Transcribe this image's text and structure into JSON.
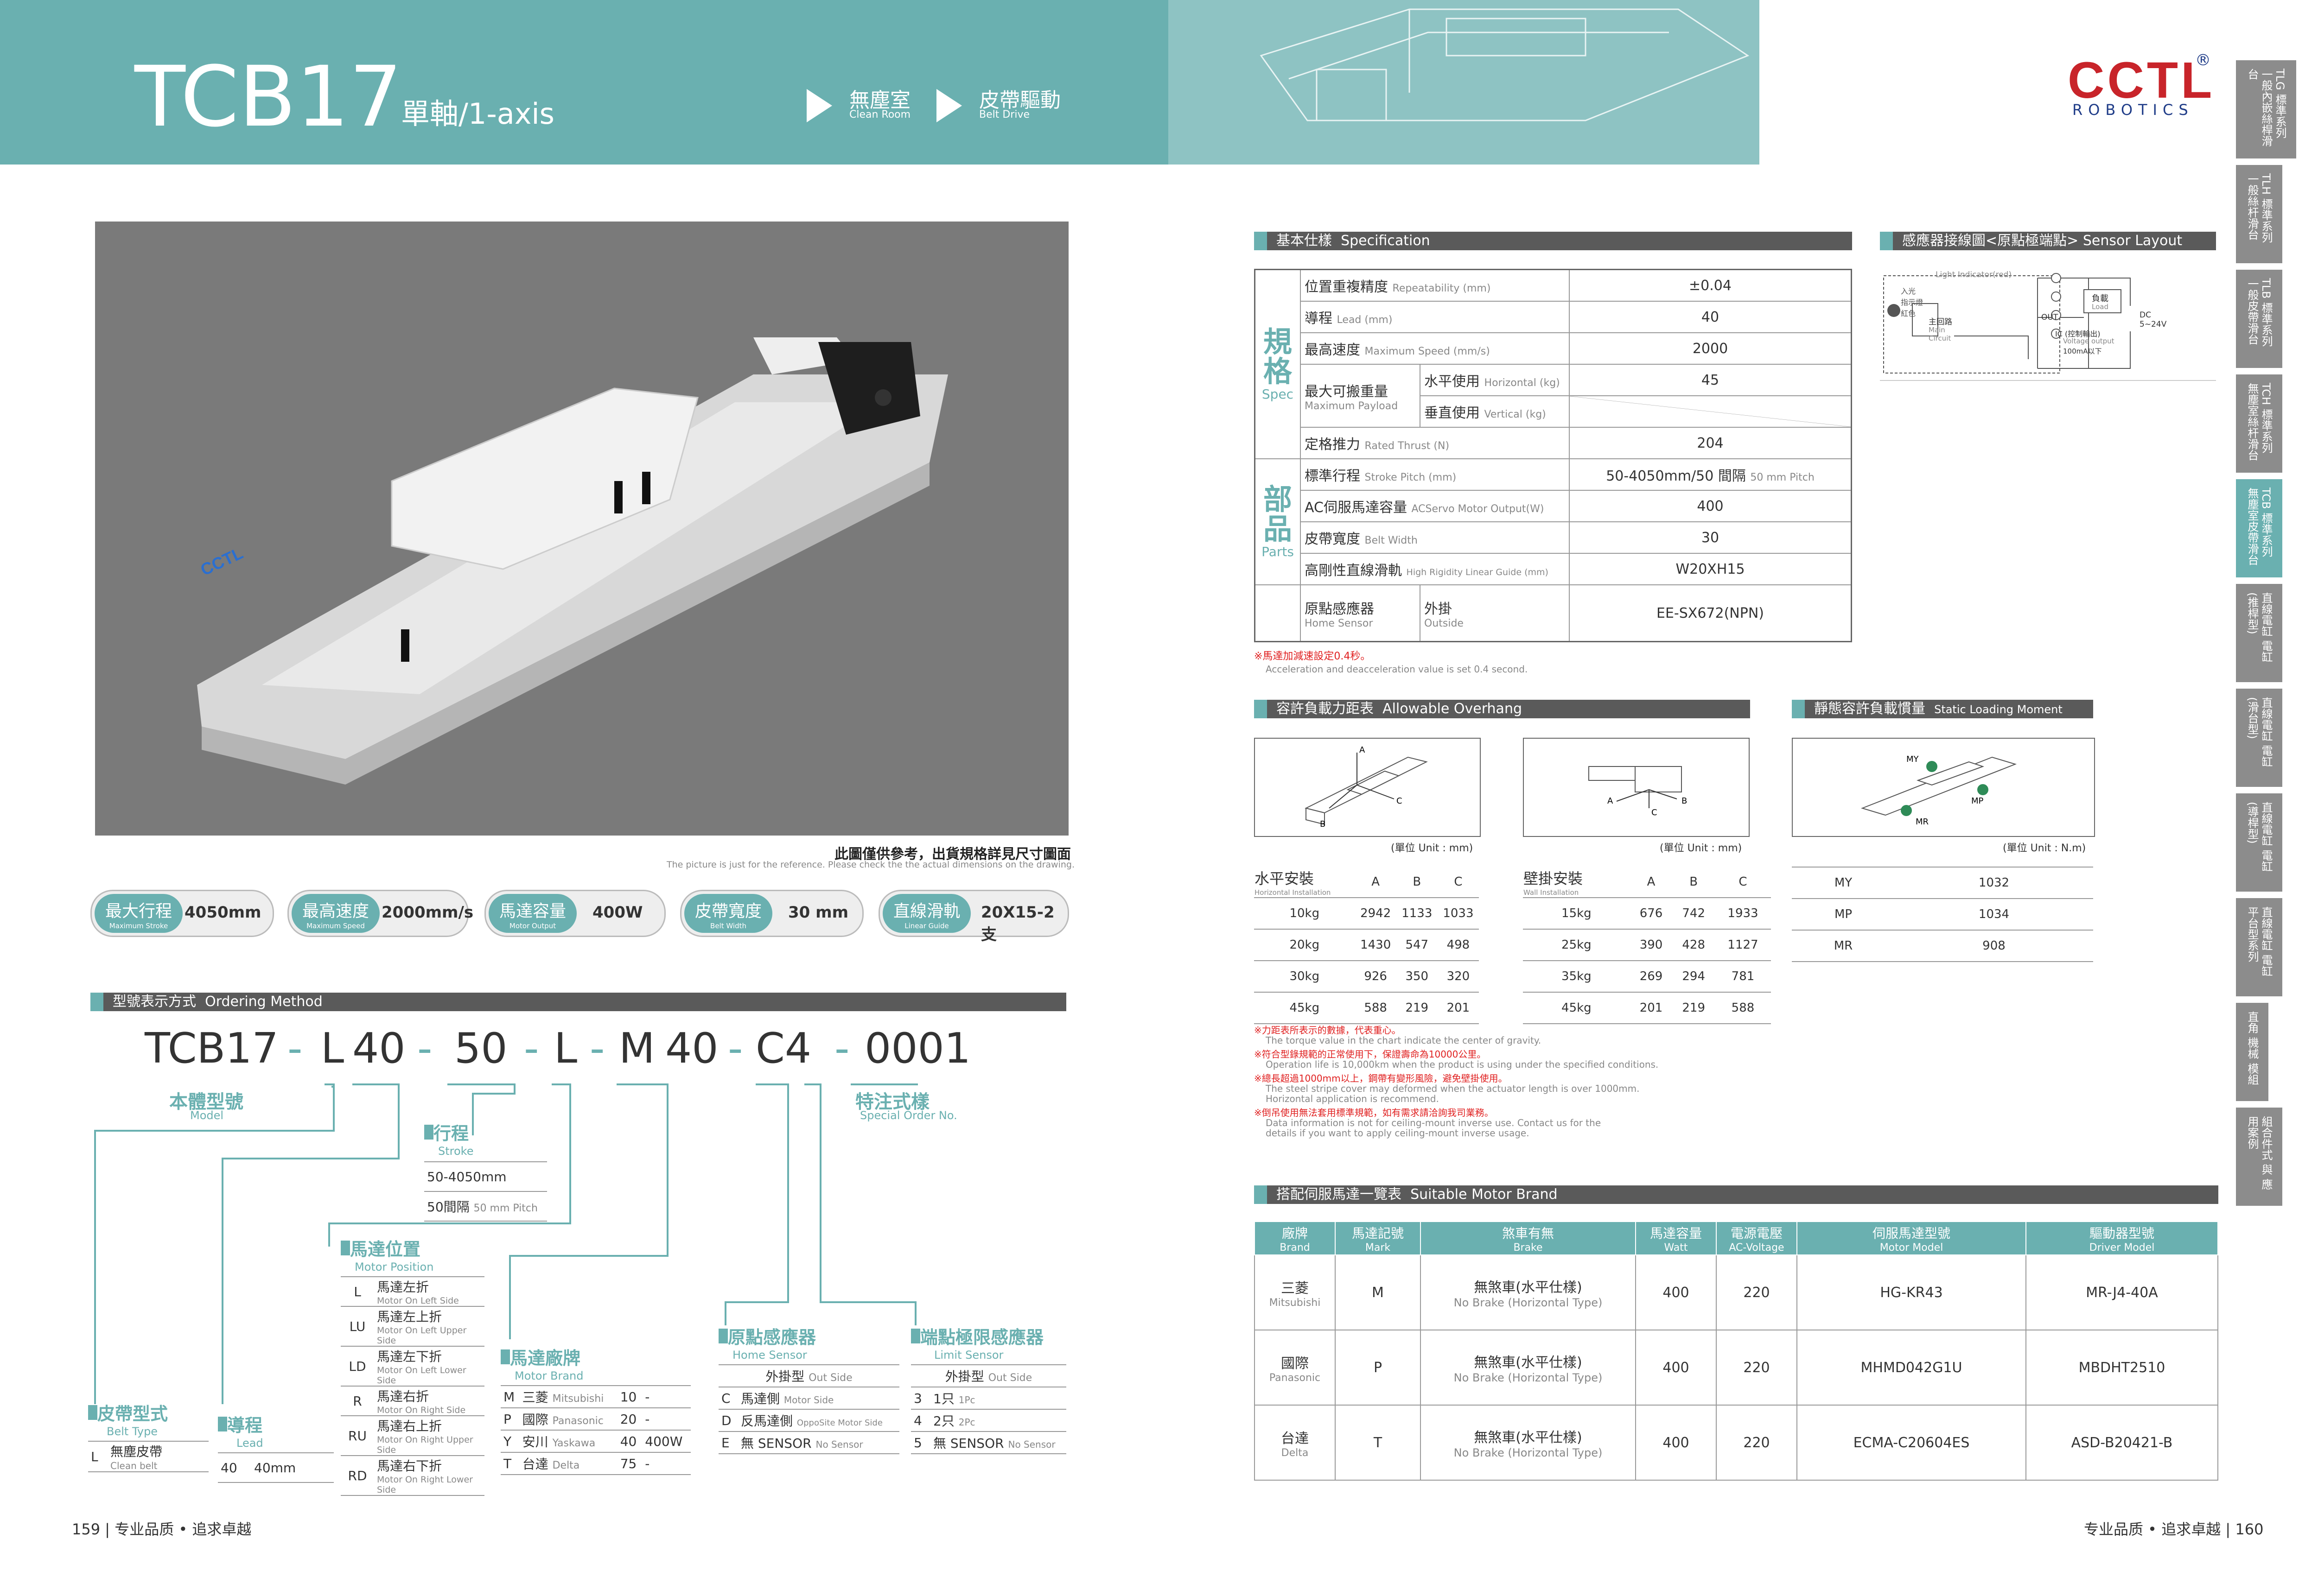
{
  "header": {
    "model": "TCB17",
    "axis": "單軸/1-axis",
    "tags": [
      {
        "zh": "無塵室",
        "en": "Clean Room"
      },
      {
        "zh": "皮帶驅動",
        "en": "Belt Drive"
      }
    ],
    "logo": {
      "brand": "CCTL",
      "reg": "®",
      "sub": "ROBOTICS"
    }
  },
  "side_tabs": [
    {
      "label": "TLG\n標準系列\n一般內嵌絲桿滑台"
    },
    {
      "label": "TLH\n標準系列\n一般絲杆滑台"
    },
    {
      "label": "TLB\n標準系列\n一般皮帶滑台"
    },
    {
      "label": "TCH\n標準系列\n無塵室絲杆滑台"
    },
    {
      "label": "TCB\n標準系列\n無塵室皮帶滑台"
    },
    {
      "label": "直線電缸\n電缸\n(推桿型)"
    },
    {
      "label": "直線電缸\n電缸\n(滑台型)"
    },
    {
      "label": "直線電缸\n電缸\n(導桿型)"
    },
    {
      "label": "直線電缸\n電缸\n平台型系列"
    },
    {
      "label": "直角\n機械\n模組"
    },
    {
      "label": "組合件式\n與\n應用案例"
    }
  ],
  "photo_note": {
    "zh": "此圖僅供參考，出貨規格詳見尺寸圖面",
    "en": "The picture is just for the reference. Please check the the actual dimensions on the drawing."
  },
  "pills": [
    {
      "zh": "最大行程",
      "en": "Maximum Stroke",
      "val": "4050mm"
    },
    {
      "zh": "最高速度",
      "en": "Maximum Speed",
      "val": "2000mm/s"
    },
    {
      "zh": "馬達容量",
      "en": "Motor Output",
      "val": "400W"
    },
    {
      "zh": "皮帶寬度",
      "en": "Belt Width",
      "val": "30 mm"
    },
    {
      "zh": "直線滑軌",
      "en": "Linear Guide",
      "val": "20X15-2支"
    }
  ],
  "ordering": {
    "title": "型號表示方式",
    "title_en": "Ordering Method",
    "code": [
      "TCB17",
      "-",
      "L",
      "40",
      "-",
      "50",
      "-",
      "L",
      "-",
      "M",
      "40",
      "-",
      "C4",
      "-",
      "0001"
    ],
    "model": {
      "zh": "本體型號",
      "en": "Model"
    },
    "special": {
      "zh": "特注式樣",
      "en": "Special Order No."
    },
    "stroke": {
      "zh": "行程",
      "en": "Stroke",
      "rows": [
        {
          "a": "50-4050mm",
          "b": ""
        },
        {
          "a": "50間隔",
          "b": "50 mm Pitch"
        }
      ]
    },
    "position": {
      "zh": "馬達位置",
      "en": "Motor Position",
      "rows": [
        {
          "k": "L",
          "zh": "馬達左折",
          "en": "Motor On Left Side"
        },
        {
          "k": "LU",
          "zh": "馬達左上折",
          "en": "Motor On Left Upper Side"
        },
        {
          "k": "LD",
          "zh": "馬達左下折",
          "en": "Motor On Left Lower Side"
        },
        {
          "k": "R",
          "zh": "馬達右折",
          "en": "Motor On Right Side"
        },
        {
          "k": "RU",
          "zh": "馬達右上折",
          "en": "Motor On Right Upper Side"
        },
        {
          "k": "RD",
          "zh": "馬達右下折",
          "en": "Motor On Right Lower Side"
        }
      ]
    },
    "brand": {
      "zh": "馬達廠牌",
      "en": "Motor Brand",
      "rows": [
        {
          "k": "M",
          "zh": "三菱",
          "en": "Mitsubishi",
          "n": "10",
          "w": "-"
        },
        {
          "k": "P",
          "zh": "國際",
          "en": "Panasonic",
          "n": "20",
          "w": "-"
        },
        {
          "k": "Y",
          "zh": "安川",
          "en": "Yaskawa",
          "n": "40",
          "w": "400W"
        },
        {
          "k": "T",
          "zh": "台達",
          "en": "Delta",
          "n": "75",
          "w": "-"
        }
      ]
    },
    "home": {
      "zh": "原點感應器",
      "en": "Home Sensor",
      "head_zh": "外掛型",
      "head_en": "Out Side",
      "rows": [
        {
          "k": "C",
          "zh": "馬達側",
          "en": "Motor Side"
        },
        {
          "k": "D",
          "zh": "反馬達側",
          "en": "OppoSite Motor Side"
        },
        {
          "k": "E",
          "zh": "無 SENSOR",
          "en": "No Sensor"
        }
      ]
    },
    "limit": {
      "zh": "端點極限感應器",
      "en": "Limit Sensor",
      "head_zh": "外掛型",
      "head_en": "Out Side",
      "rows": [
        {
          "k": "3",
          "zh": "1只",
          "en": "1Pc"
        },
        {
          "k": "4",
          "zh": "2只",
          "en": "2Pc"
        },
        {
          "k": "5",
          "zh": "無 SENSOR",
          "en": "No Sensor"
        }
      ]
    },
    "belt": {
      "zh": "皮帶型式",
      "en": "Belt Type",
      "k": "L",
      "v_zh": "無塵皮帶",
      "v_en": "Clean belt"
    },
    "lead": {
      "zh": "導程",
      "en": "Lead",
      "k": "40",
      "v": "40mm"
    }
  },
  "spec": {
    "title": "基本仕樣",
    "title_en": "Specification",
    "group1": {
      "zh": "規格",
      "en": "Spec"
    },
    "group2": {
      "zh": "部品",
      "en": "Parts"
    },
    "rows": [
      {
        "zh": "位置重複精度",
        "en": "Repeatability (mm)",
        "v": "±0.04"
      },
      {
        "zh": "導程",
        "en": "Lead (mm)",
        "v": "40"
      },
      {
        "zh": "最高速度",
        "en": "Maximum Speed (mm/s)",
        "v": "2000"
      },
      {
        "zh": "最大可搬重量",
        "en": "Maximum Payload",
        "h_zh": "水平使用",
        "h_en": "Horizontal (kg)",
        "h_v": "45",
        "v_zh": "垂直使用",
        "v_en": "Vertical (kg)"
      },
      {
        "zh": "定格推力",
        "en": "Rated Thrust (N)",
        "v": "204"
      },
      {
        "zh": "標準行程",
        "en": "Stroke Pitch (mm)",
        "v": "50-4050mm/50 間隔",
        "v2": "50 mm Pitch"
      },
      {
        "zh": "AC伺服馬達容量",
        "en": "ACServo Motor Output(W)",
        "v": "400"
      },
      {
        "zh": "皮帶寬度",
        "en": "Belt Width",
        "v": "30"
      },
      {
        "zh": "高剛性直線滑軌",
        "en": "High Rigidity Linear Guide (mm)",
        "v": "W20XH15"
      },
      {
        "zh": "原點感應器",
        "en": "Home Sensor",
        "o_zh": "外掛",
        "o_en": "Outside",
        "v": "EE-SX672(NPN)"
      }
    ],
    "note_zh": "※馬達加減速設定0.4秒。",
    "note_en": "Acceleration and deacceleration value is set 0.4 second."
  },
  "sensor": {
    "title": "感應器接線圖<原點極端點>",
    "title_en": "Sensor Layout",
    "light": "Light Indicator(red)",
    "light_zh": "入光\n指示燈\n紅色",
    "main_zh": "主回路",
    "main_en": "Main\nCircuit",
    "load_zh": "負載",
    "load_en": "Load",
    "out": "OUT",
    "ic": "IC (控制輸出)",
    "vo": "Voltage output",
    "ma": "100mA以下",
    "dc": "DC\n5~24V"
  },
  "overhang": {
    "title": "容許負載力距表",
    "title_en": "Allowable Overhang",
    "unit": "(單位 Unit : mm)",
    "h": {
      "zh": "水平安裝",
      "en": "Horizontal Installation",
      "cols": [
        "A",
        "B",
        "C"
      ],
      "rows": [
        [
          "10kg",
          "2942",
          "1133",
          "1033"
        ],
        [
          "20kg",
          "1430",
          "547",
          "498"
        ],
        [
          "30kg",
          "926",
          "350",
          "320"
        ],
        [
          "45kg",
          "588",
          "219",
          "201"
        ]
      ]
    },
    "w": {
      "zh": "壁掛安裝",
      "en": "Wall Installation",
      "cols": [
        "A",
        "B",
        "C"
      ],
      "rows": [
        [
          "15kg",
          "676",
          "742",
          "1933"
        ],
        [
          "25kg",
          "390",
          "428",
          "1127"
        ],
        [
          "35kg",
          "269",
          "294",
          "781"
        ],
        [
          "45kg",
          "201",
          "219",
          "588"
        ]
      ]
    },
    "notes": [
      {
        "zh": "※力距表所表示的數據，代表重心。",
        "en": "The torque value in the chart indicate the center of gravity."
      },
      {
        "zh": "※符合型錄規範的正常使用下，保證壽命為10000公里。",
        "en": "Operation life is 10,000km  when the product is using under the specified conditions."
      },
      {
        "zh": "※總長超過1000mm以上，鋼帶有變形風險，避免壁掛使用。",
        "en": "The steel stripe cover may deformed when the actuator length is over 1000mm. Horizontal application is recommend."
      },
      {
        "zh": "※倒吊使用無法套用標準規範，如有需求請洽詢我司業務。",
        "en": "Data information is not for ceiling-mount inverse use. Contact us for the details if you want to apply ceiling-mount inverse usage."
      }
    ]
  },
  "moment": {
    "title": "靜態容許負載慣量",
    "title_en": "Static Loading Moment",
    "unit": "(單位 Unit : N.m)",
    "rows": [
      [
        "MY",
        "1032"
      ],
      [
        "MP",
        "1034"
      ],
      [
        "MR",
        "908"
      ]
    ]
  },
  "motor": {
    "title": "搭配伺服馬達一覽表",
    "title_en": "Suitable Motor Brand",
    "headers": [
      {
        "zh": "廠牌",
        "en": "Brand"
      },
      {
        "zh": "馬達記號",
        "en": "Mark"
      },
      {
        "zh": "煞車有無",
        "en": "Brake"
      },
      {
        "zh": "馬達容量",
        "en": "Watt"
      },
      {
        "zh": "電源電壓",
        "en": "AC-Voltage"
      },
      {
        "zh": "伺服馬達型號",
        "en": "Motor Model"
      },
      {
        "zh": "驅動器型號",
        "en": "Driver Model"
      }
    ],
    "rows": [
      {
        "b_zh": "三菱",
        "b_en": "Mitsubishi",
        "mark": "M",
        "br_zh": "無煞車(水平仕樣)",
        "br_en": "No Brake (Horizontal Type)",
        "w": "400",
        "v": "220",
        "model": "HG-KR43",
        "driver": "MR-J4-40A"
      },
      {
        "b_zh": "國際",
        "b_en": "Panasonic",
        "mark": "P",
        "br_zh": "無煞車(水平仕樣)",
        "br_en": "No Brake (Horizontal Type)",
        "w": "400",
        "v": "220",
        "model": "MHMD042G1U",
        "driver": "MBDHT2510"
      },
      {
        "b_zh": "台達",
        "b_en": "Delta",
        "mark": "T",
        "br_zh": "無煞車(水平仕樣)",
        "br_en": "No Brake (Horizontal Type)",
        "w": "400",
        "v": "220",
        "model": "ECMA-C20604ES",
        "driver": "ASD-B20421-B"
      }
    ]
  },
  "footer": {
    "left_num": "159",
    "left_text": "专业品质 • 追求卓越",
    "right_text": "专业品质 • 追求卓越",
    "right_num": "160"
  }
}
